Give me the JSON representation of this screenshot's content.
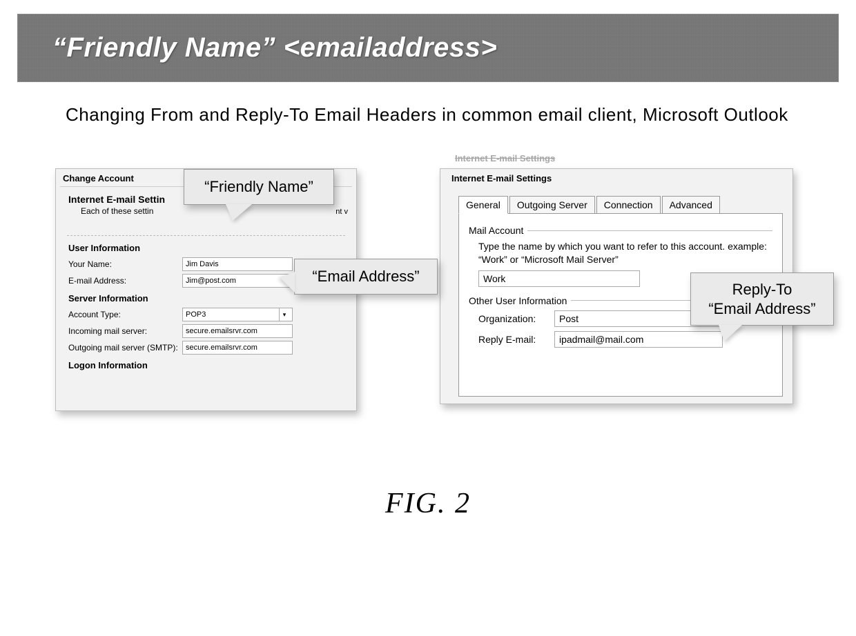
{
  "banner": {
    "title": "“Friendly Name” <emailaddress>"
  },
  "caption": "Changing From and Reply-To Email Headers in common email client, Microsoft Outlook",
  "left": {
    "window_title": "Change Account",
    "heading": "Internet E-mail Settin",
    "subheading": "Each of these settin",
    "trailing_fragment": "nt v",
    "groups": {
      "user_info": "User Information",
      "server_info": "Server Information",
      "logon_info": "Logon Information"
    },
    "fields": {
      "your_name_label": "Your Name:",
      "your_name_value": "Jim Davis",
      "email_label": "E-mail Address:",
      "email_value": "Jim@post.com",
      "account_type_label": "Account Type:",
      "account_type_value": "POP3",
      "incoming_label": "Incoming mail server:",
      "incoming_value": "secure.emailsrvr.com",
      "outgoing_label": "Outgoing mail server (SMTP):",
      "outgoing_value": "secure.emailsrvr.com"
    },
    "callouts": {
      "friendly": "“Friendly Name”",
      "email": "“Email Address”"
    }
  },
  "right": {
    "ghost_title": "Internet E-mail Settings",
    "window_title": "Internet E-mail Settings",
    "tabs": {
      "general": "General",
      "outgoing": "Outgoing Server",
      "connection": "Connection",
      "advanced": "Advanced"
    },
    "mail_account_legend": "Mail Account",
    "mail_account_desc": "Type the name by which you want to refer to this account. example: “Work” or “Microsoft Mail Server”",
    "mail_account_value": "Work",
    "other_user_legend": "Other User Information",
    "org_label": "Organization:",
    "org_value": "Post",
    "reply_label": "Reply E-mail:",
    "reply_value": "ipadmail@mail.com",
    "callout": {
      "line1": "Reply-To",
      "line2": "“Email Address”"
    }
  },
  "figure_label": "FIG. 2"
}
